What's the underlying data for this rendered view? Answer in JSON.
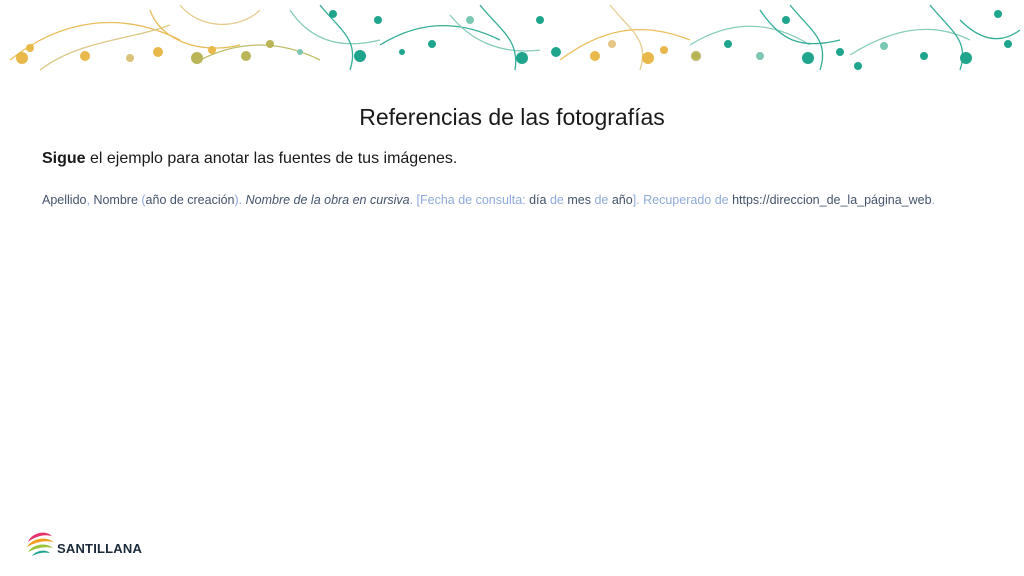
{
  "slide": {
    "title": "Referencias de las fotografías",
    "instruction": {
      "bold": "Sigue",
      "rest": " el ejemplo para anotar las fuentes de tus imágenes."
    },
    "example": {
      "apellido": "Apellido",
      "sep1": ", ",
      "nombre": "Nombre",
      "paren_open": " (",
      "anio_creacion": "año de creación",
      "paren_close": "). ",
      "obra": "Nombre de la obra en cursiva",
      "consulta_open": ". [Fecha de consulta: ",
      "dia": "día",
      "de1": " de ",
      "mes": "mes",
      "de2": " de ",
      "anio": "año",
      "recuperado": "]. Recuperado de ",
      "url": "https://direccion_de_la_página_web",
      "end": "."
    },
    "logo": {
      "text": "SANTILLANA"
    }
  },
  "colors": {
    "gold": "#e8b84a",
    "olive": "#b9b558",
    "teal": "#1fa58b",
    "light_blue_text": "#8faadc",
    "dark_blue_text": "#44546a"
  }
}
